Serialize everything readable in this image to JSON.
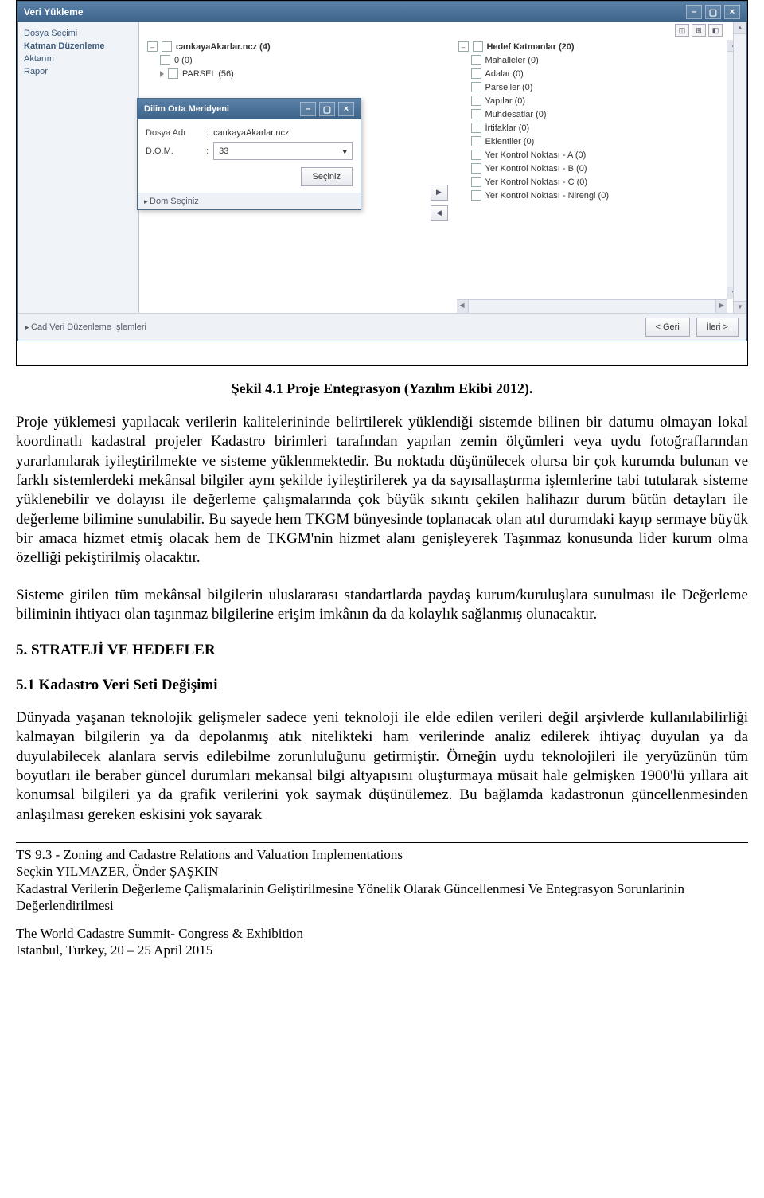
{
  "app": {
    "title": "Veri Yükleme",
    "sidebar": {
      "items": [
        {
          "label": "Dosya Seçimi",
          "bold": false
        },
        {
          "label": "Katman Düzenleme",
          "bold": true
        },
        {
          "label": "Aktarım",
          "bold": false
        },
        {
          "label": "Rapor",
          "bold": false
        }
      ]
    },
    "leftTree": {
      "root": "cankayaAkarlar.ncz  (4)",
      "children": [
        {
          "label": "0  (0)"
        },
        {
          "label": "PARSEL (56)"
        }
      ]
    },
    "rightTree": {
      "root": "Hedef Katmanlar (20)",
      "children": [
        {
          "label": "Mahalleler  (0)"
        },
        {
          "label": "Adalar  (0)"
        },
        {
          "label": "Parseller  (0)"
        },
        {
          "label": "Yapılar  (0)"
        },
        {
          "label": "Muhdesatlar  (0)"
        },
        {
          "label": "İrtifaklar  (0)"
        },
        {
          "label": "Eklentiler  (0)"
        },
        {
          "label": "Yer Kontrol Noktası - A  (0)"
        },
        {
          "label": "Yer Kontrol Noktası - B  (0)"
        },
        {
          "label": "Yer Kontrol Noktası - C  (0)"
        },
        {
          "label": "Yer Kontrol Noktası - Nirengi  (0)"
        }
      ]
    },
    "dialog": {
      "title": "Dilim Orta Meridyeni",
      "fileLabel": "Dosya Adı",
      "fileValue": "cankayaAkarlar.ncz",
      "domLabel": "D.O.M.",
      "domValue": "33",
      "button": "Seçiniz",
      "status": "Dom Seçiniz"
    },
    "status": {
      "left": "Cad Veri Düzenleme İşlemleri",
      "back": "<  Geri",
      "next": "İleri >"
    }
  },
  "caption": "Şekil 4.1 Proje Entegrasyon (Yazılım Ekibi 2012).",
  "paragraphs": {
    "p1": "Proje yüklemesi yapılacak verilerin kalitelerininde belirtilerek yüklendiği sistemde bilinen bir datumu olmayan lokal koordinatlı kadastral projeler Kadastro birimleri tarafından yapılan zemin ölçümleri veya uydu fotoğraflarından yararlanılarak iyileştirilmekte ve sisteme yüklenmektedir. Bu noktada düşünülecek olursa bir çok kurumda bulunan ve farklı sistemlerdeki mekânsal bilgiler aynı şekilde iyileştirilerek ya da sayısallaştırma işlemlerine tabi tutularak sisteme yüklenebilir ve dolayısı ile değerleme çalışmalarında çok büyük sıkıntı çekilen halihazır durum bütün detayları ile değerleme bilimine sunulabilir. Bu sayede hem TKGM bünyesinde toplanacak olan atıl durumdaki kayıp sermaye büyük bir amaca hizmet etmiş olacak hem de TKGM'nin hizmet alanı genişleyerek Taşınmaz konusunda lider kurum olma özelliği pekiştirilmiş olacaktır.",
    "p2": "Sisteme girilen tüm mekânsal bilgilerin  uluslararası standartlarda paydaş kurum/kuruluşlara sunulması ile Değerleme biliminin ihtiyacı olan taşınmaz bilgilerine erişim imkânın da da kolaylık sağlanmış olunacaktır.",
    "p3": "Dünyada yaşanan teknolojik gelişmeler sadece yeni teknoloji ile elde edilen verileri değil arşivlerde kullanılabilirliği kalmayan bilgilerin ya da depolanmış atık nitelikteki ham verilerinde analiz edilerek ihtiyaç duyulan ya da duyulabilecek alanlara servis edilebilme zorunluluğunu getirmiştir. Örneğin uydu teknolojileri ile yeryüzünün tüm boyutları ile beraber güncel durumları mekansal bilgi altyapısını oluşturmaya müsait hale gelmişken 1900'lü yıllara ait konumsal bilgileri ya da grafik verilerini yok saymak düşünülemez. Bu bağlamda kadastronun güncellenmesinden anlaşılması gereken eskisini yok sayarak"
  },
  "headings": {
    "h5": "5. STRATEJİ VE HEDEFLER",
    "h51": " 5.1 Kadastro Veri Seti Değişimi"
  },
  "footer": {
    "line1": "TS 9.3 - Zoning and Cadastre Relations and Valuation Implementations",
    "line2": "Seçkin YILMAZER, Önder ŞAŞKIN",
    "line3": "Kadastral Verilerin Değerleme Çalişmalarinin Geliştirilmesine Yönelik Olarak Güncellenmesi Ve Entegrasyon Sorunlarinin Değerlendirilmesi",
    "line4": "The World Cadastre Summit- Congress & Exhibition",
    "line5": "Istanbul, Turkey, 20 – 25 April 2015"
  }
}
